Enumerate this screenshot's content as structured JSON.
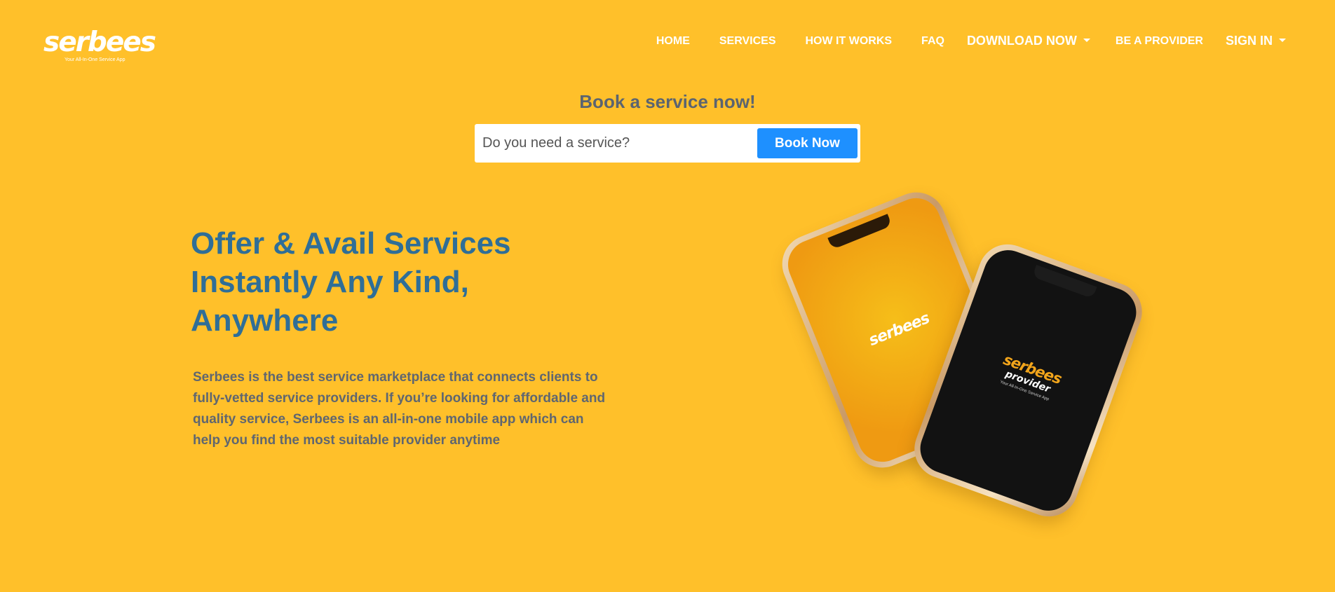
{
  "brand": {
    "name": "serbees",
    "tagline": "Your All-In-One Service App"
  },
  "nav": {
    "home": "HOME",
    "services": "SERVICES",
    "how_it_works": "HOW IT WORKS",
    "faq": "FAQ",
    "download_now": "DOWNLOAD NOW",
    "be_a_provider": "BE A PROVIDER",
    "sign_in": "SIGN IN"
  },
  "booking": {
    "heading": "Book a service now!",
    "placeholder": "Do you need a service?",
    "button": "Book Now"
  },
  "hero": {
    "title_lines": [
      "Offer & Avail Services",
      "Instantly Any Kind,",
      "Anywhere"
    ],
    "description": "Serbees is the best service marketplace that connects clients to fully-vetted service providers. If you’re looking for affordable and quality service, Serbees is an all-in-one mobile app which can help you find the most suitable provider anytime"
  },
  "phones": {
    "client_label": "serbees",
    "provider_label": "serbees",
    "provider_sub": "provider",
    "provider_tagline": "Your All-In-One Service App"
  },
  "colors": {
    "background": "#FFC02A",
    "accent_blue": "#1E90FF",
    "title_blue": "#2F6E97"
  }
}
